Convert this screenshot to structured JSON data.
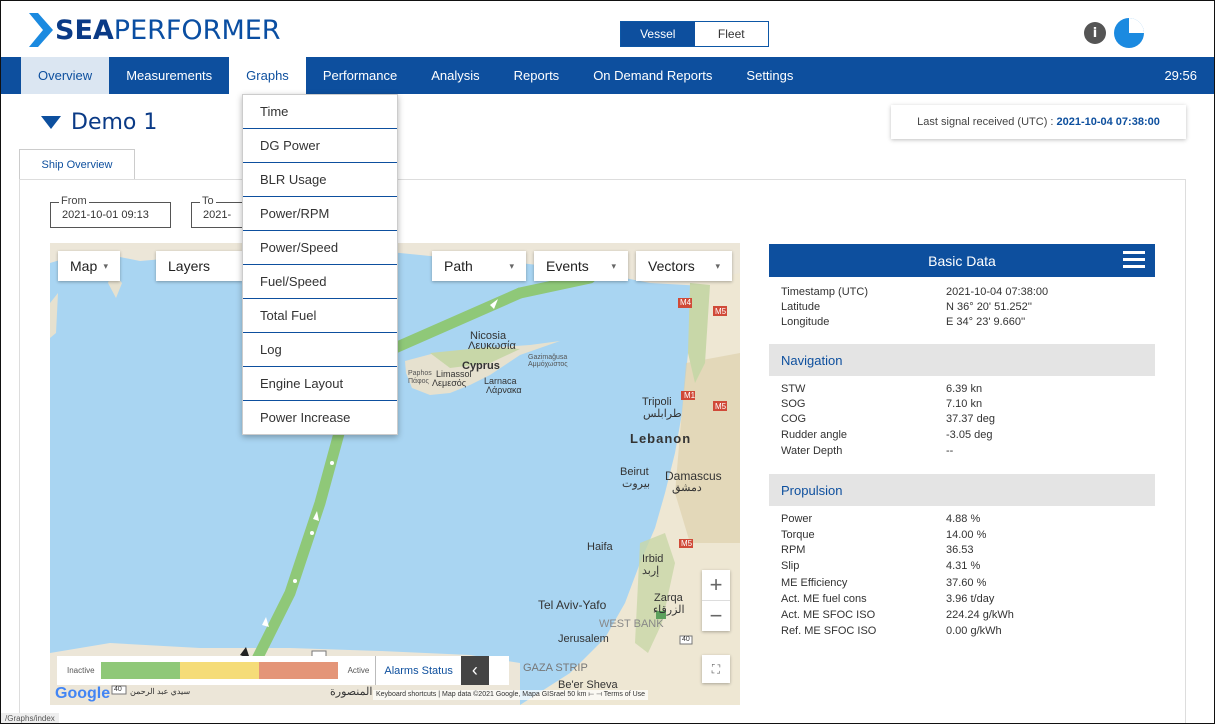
{
  "brand": {
    "name_bold": "SEA",
    "name_rest": "PERFORMER"
  },
  "view_toggle": {
    "vessel": "Vessel",
    "fleet": "Fleet"
  },
  "header_icons": {
    "info": "i",
    "info_icon": "info-icon",
    "user_icon": "user-icon"
  },
  "nav": {
    "overview": "Overview",
    "measurements": "Measurements",
    "graphs": "Graphs",
    "performance": "Performance",
    "analysis": "Analysis",
    "reports": "Reports",
    "on_demand": "On Demand Reports",
    "settings": "Settings",
    "clock": "29:56"
  },
  "vessel_title": "Demo 1",
  "signal": {
    "label": "Last signal received (UTC) :",
    "value": "2021-10-04 07:38:00"
  },
  "tab": "Ship Overview",
  "range": {
    "from_label": "From",
    "from_value": "2021-10-01 09:13",
    "to_label": "To",
    "to_value": "2021-"
  },
  "graphs_menu": [
    "Time",
    "DG Power",
    "BLR Usage",
    "Power/RPM",
    "Power/Speed",
    "Fuel/Speed",
    "Total Fuel",
    "Log",
    "Engine Layout",
    "Power Increase"
  ],
  "map": {
    "type": "Map",
    "layers": "Layers",
    "path": "Path",
    "events": "Events",
    "vectors": "Vectors",
    "zoom_in": "+",
    "zoom_out": "−",
    "fullscreen": "⛶",
    "alarms": {
      "inactive": "Inactive",
      "active": "Active",
      "status": "Alarms Status",
      "collapse": "‹",
      "colors": [
        "#8fc878",
        "#f5dc78",
        "#e49578"
      ]
    },
    "labels": {
      "nicosia": "Nicosia",
      "nicosia_gr": "Λευκωσία",
      "cyprus": "Cyprus",
      "gazimagusa": "Gazimağusa",
      "ammochostos": "Αμμόχωστος",
      "paphos": "Paphos",
      "paphos_gr": "Πάφος",
      "limassol": "Limassol",
      "lemesos": "Λεμεσός",
      "larnaca": "Larnaca",
      "larnaka_gr": "Λάρνακα",
      "tripoli": "Tripoli",
      "tripoli_ar": "طرابلس",
      "lebanon": "Lebanon",
      "beirut": "Beirut",
      "beirut_ar": "بيروت",
      "damascus": "Damascus",
      "damascus_ar": "دمشق",
      "haifa": "Haifa",
      "irbid": "Irbid",
      "irbid_ar": "إربد",
      "tel_aviv": "Tel Aviv-Yafo",
      "zarqa": "Zarqa",
      "zarqa_ar": "الزرقاء",
      "west_bank": "WEST BANK",
      "jerusalem": "Jerusalem",
      "gaza": "GAZA STRIP",
      "beer_sheva": "Be'er Sheva",
      "mansoura": "المنصورة",
      "sidi_abd": "سيدي عبد الرحمن",
      "m4": "M4",
      "m5": "M5",
      "m1": "M1",
      "r40": "40"
    },
    "google": "Google",
    "attribution": "Keyboard shortcuts | Map data ©2021 Google, Mapa GISrael   50 km ⟝      ⟞   Terms of Use"
  },
  "basic_data": {
    "title": "Basic Data",
    "rows": [
      {
        "k": "Timestamp (UTC)",
        "v": "2021-10-04 07:38:00"
      },
      {
        "k": "Latitude",
        "v": "N 36° 20' 51.252''"
      },
      {
        "k": "Longitude",
        "v": "E 34° 23' 9.660''"
      }
    ],
    "navigation_title": "Navigation",
    "navigation": [
      {
        "k": "STW",
        "v": "6.39 kn"
      },
      {
        "k": "SOG",
        "v": "7.10 kn"
      },
      {
        "k": "COG",
        "v": "37.37 deg"
      },
      {
        "k": "Rudder angle",
        "v": "-3.05 deg"
      },
      {
        "k": "Water Depth",
        "v": "--"
      }
    ],
    "propulsion_title": "Propulsion",
    "propulsion": [
      {
        "k": "Power",
        "v": "4.88 %"
      },
      {
        "k": "Torque",
        "v": "14.00 %"
      },
      {
        "k": "RPM",
        "v": "36.53"
      },
      {
        "k": "Slip",
        "v": "4.31 %"
      },
      {
        "k": "ME Efficiency",
        "v": "37.60 %"
      },
      {
        "k": "Act. ME fuel cons",
        "v": "3.96 t/day"
      },
      {
        "k": "Act. ME SFOC ISO",
        "v": "224.24 g/kWh"
      },
      {
        "k": "Ref. ME SFOC ISO",
        "v": "0.00 g/kWh"
      }
    ]
  },
  "status_url": "/Graphs/index"
}
